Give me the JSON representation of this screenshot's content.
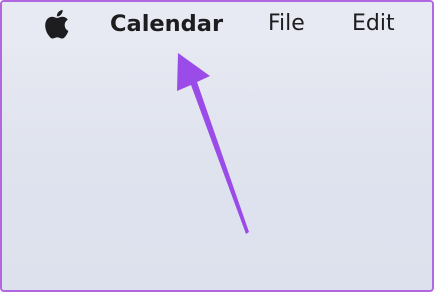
{
  "menubar": {
    "apple_icon": "apple-logo-icon",
    "app_name": "Calendar",
    "items": [
      {
        "label": "File"
      },
      {
        "label": "Edit"
      }
    ]
  },
  "annotation": {
    "icon": "arrow-icon",
    "color": "#9b4be8"
  },
  "colors": {
    "border": "#b067e0",
    "menubar_bg": "#e8eaf3",
    "desktop_bg": "#dfe3ee",
    "text": "#1d1d1f"
  }
}
